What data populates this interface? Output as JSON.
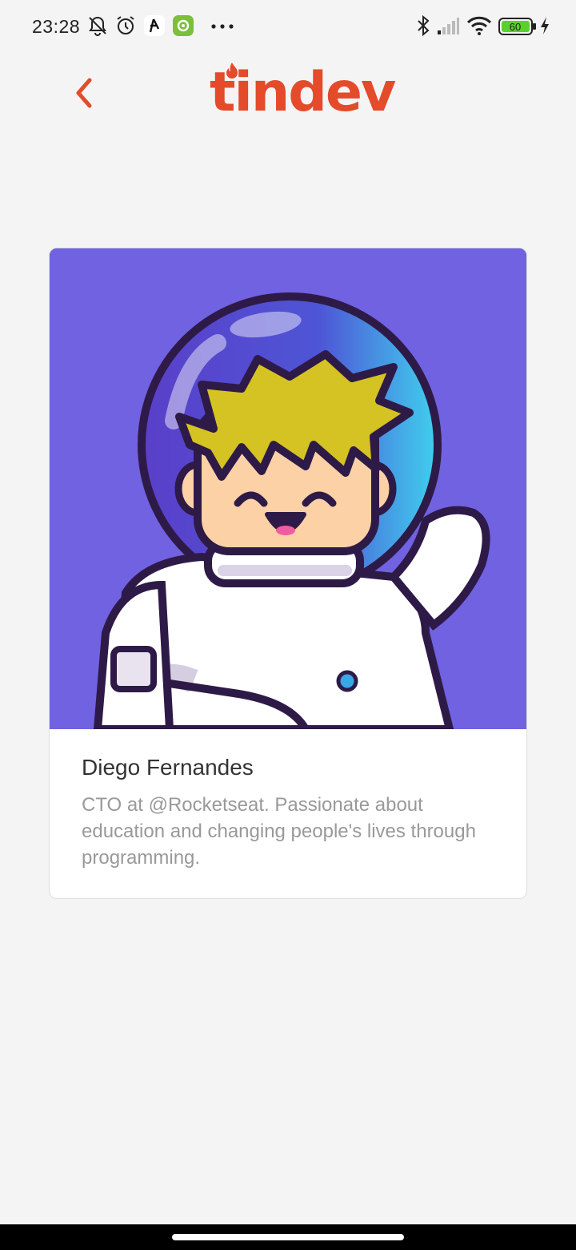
{
  "status_bar": {
    "time": "23:28",
    "battery_level": "60",
    "icons": [
      "mute-icon",
      "alarm-icon",
      "app-notification-icon",
      "settings-notification-icon",
      "more-dots-icon",
      "bluetooth-icon",
      "signal-icon",
      "wifi-icon",
      "battery-icon",
      "charging-icon"
    ]
  },
  "header": {
    "logo_text": "tindev",
    "back_icon": "chevron-left-icon"
  },
  "colors": {
    "brand": "#e34b2a",
    "background": "#f4f4f4",
    "avatar_bg": "#7062e0"
  },
  "profile": {
    "name": "Diego Fernandes",
    "bio": "CTO at @Rocketseat. Passionate about education and changing people's lives through programming."
  }
}
